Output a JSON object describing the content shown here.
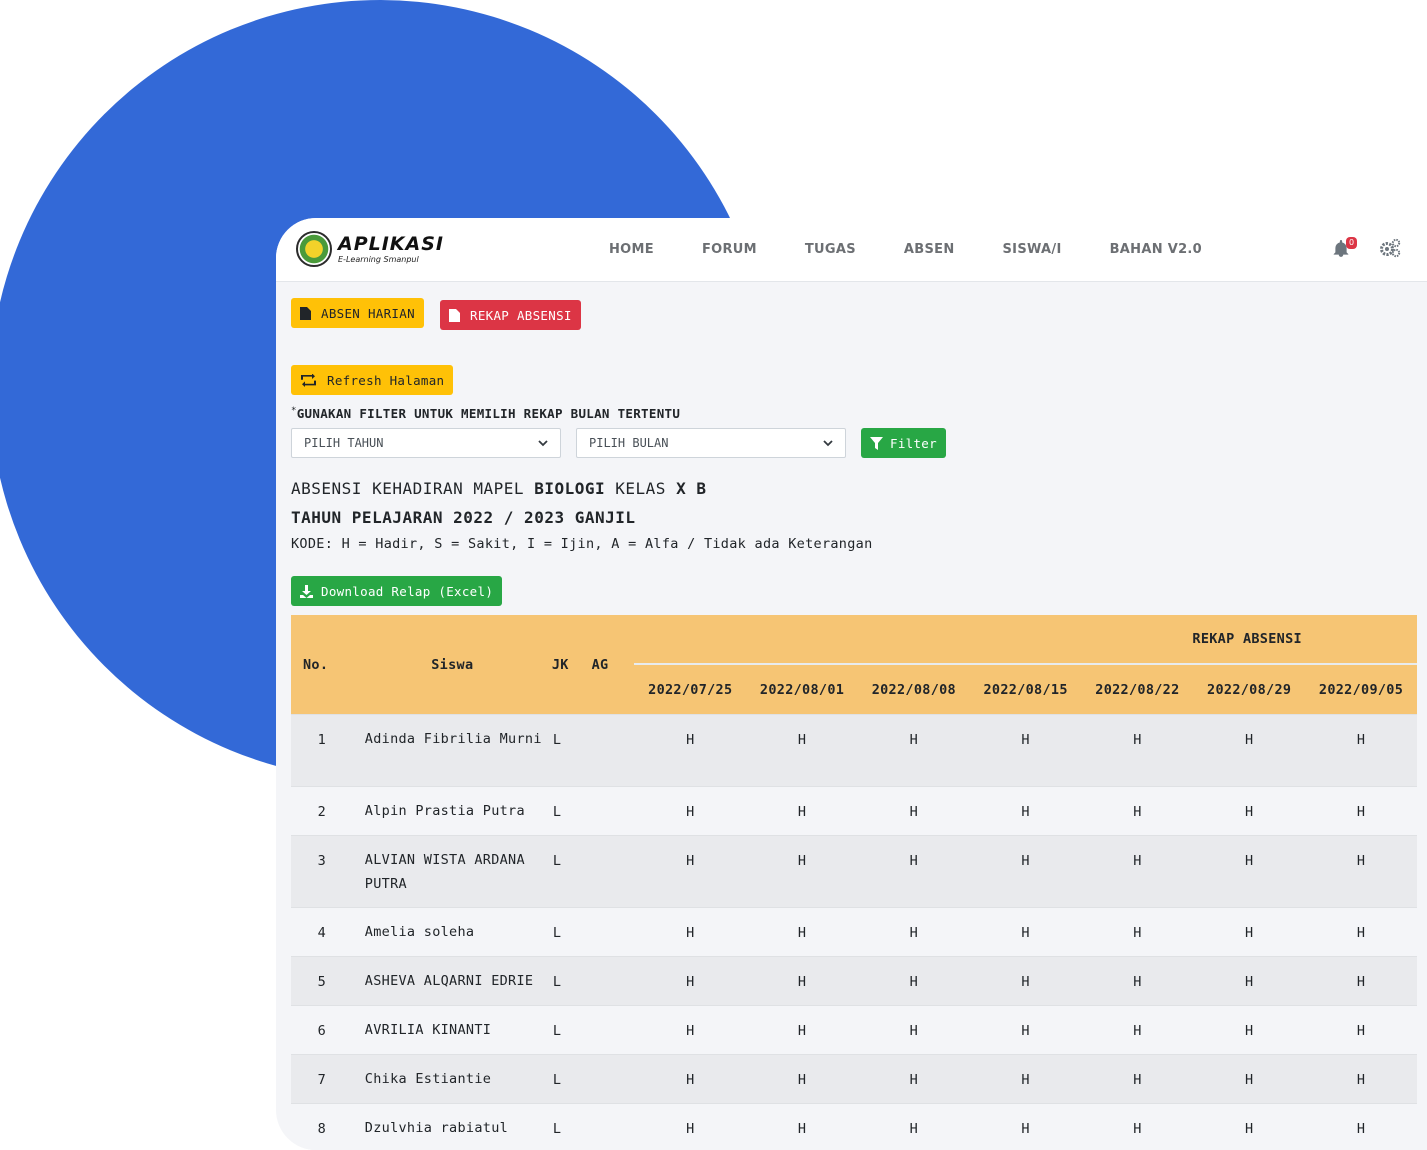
{
  "nav": {
    "logo_title": "APLIKASI",
    "logo_subtitle": "E-Learning Smanpul",
    "links": [
      "HOME",
      "FORUM",
      "TUGAS",
      "ABSEN",
      "SISWA/I",
      "BAHAN V2.0"
    ],
    "notification_count": "0"
  },
  "buttons": {
    "absen_harian": "ABSEN HARIAN",
    "rekap_absensi": "REKAP ABSENSI",
    "refresh": "Refresh Halaman",
    "filter": "Filter",
    "download": "Download Relap (Excel)"
  },
  "filter": {
    "note_star": "*",
    "note": "GUNAKAN FILTER UNTUK MEMILIH REKAP BULAN TERTENTU",
    "year_placeholder": "PILIH TAHUN",
    "month_placeholder": "PILIH BULAN"
  },
  "heading": {
    "line1_prefix": "ABSENSI KEHADIRAN MAPEL ",
    "subject": "BIOLOGI",
    "line1_mid": " KELAS ",
    "kelas": "X B",
    "line2": "TAHUN PELAJARAN 2022 / 2023 GANJIL",
    "kode": "KODE: H = Hadir, S = Sakit, I = Ijin, A = Alfa / Tidak ada Keterangan"
  },
  "table": {
    "headers": {
      "no": "No.",
      "siswa": "Siswa",
      "jk": "JK",
      "ag": "AG",
      "rekap": "REKAP ABSENSI"
    },
    "dates": [
      "2022/07/25",
      "2022/08/01",
      "2022/08/08",
      "2022/08/15",
      "2022/08/22",
      "2022/08/29",
      "2022/09/05"
    ],
    "rows": [
      {
        "no": "1",
        "siswa": "Adinda Fibrilia Murni",
        "jk": "L",
        "ag": "",
        "marks": [
          "H",
          "H",
          "H",
          "H",
          "H",
          "H",
          "H"
        ]
      },
      {
        "no": "2",
        "siswa": "Alpin Prastia Putra",
        "jk": "L",
        "ag": "",
        "marks": [
          "H",
          "H",
          "H",
          "H",
          "H",
          "H",
          "H"
        ]
      },
      {
        "no": "3",
        "siswa": "ALVIAN WISTA ARDANA PUTRA",
        "jk": "L",
        "ag": "",
        "marks": [
          "H",
          "H",
          "H",
          "H",
          "H",
          "H",
          "H"
        ]
      },
      {
        "no": "4",
        "siswa": "Amelia soleha",
        "jk": "L",
        "ag": "",
        "marks": [
          "H",
          "H",
          "H",
          "H",
          "H",
          "H",
          "H"
        ]
      },
      {
        "no": "5",
        "siswa": "ASHEVA ALQARNI EDRIE",
        "jk": "L",
        "ag": "",
        "marks": [
          "H",
          "H",
          "H",
          "H",
          "H",
          "H",
          "H"
        ]
      },
      {
        "no": "6",
        "siswa": "AVRILIA KINANTI",
        "jk": "L",
        "ag": "",
        "marks": [
          "H",
          "H",
          "H",
          "H",
          "H",
          "H",
          "H"
        ]
      },
      {
        "no": "7",
        "siswa": "Chika Estiantie",
        "jk": "L",
        "ag": "",
        "marks": [
          "H",
          "H",
          "H",
          "H",
          "H",
          "H",
          "H"
        ]
      },
      {
        "no": "8",
        "siswa": "Dzulvhia rabiatul",
        "jk": "L",
        "ag": "",
        "marks": [
          "H",
          "H",
          "H",
          "H",
          "H",
          "H",
          "H"
        ]
      }
    ]
  }
}
